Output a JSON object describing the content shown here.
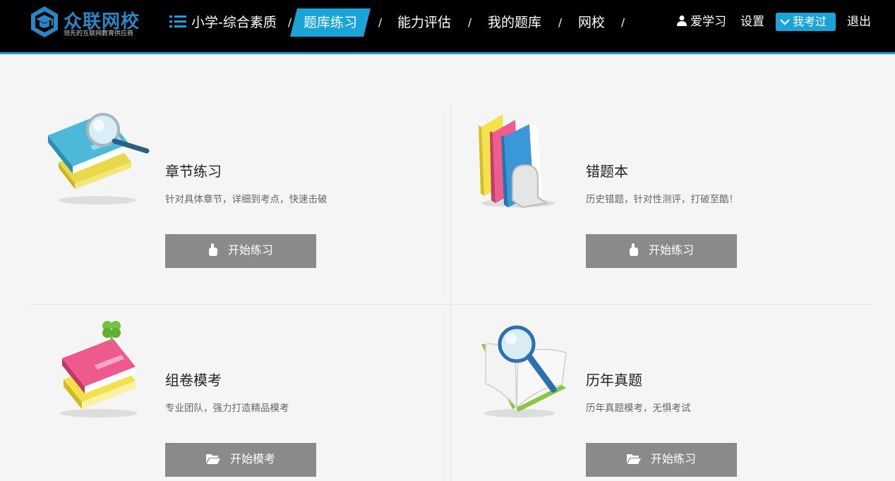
{
  "brand": {
    "name": "众联网校",
    "slogan": "领先的互联网教育供应商",
    "accent": "#1aa3d6",
    "logo_color": "#2b86c5"
  },
  "nav": {
    "menu_icon": "list-icon",
    "items": [
      {
        "label": "小学-综合素质"
      },
      {
        "label": "题库练习",
        "active": true
      },
      {
        "label": "能力评估"
      },
      {
        "label": "我的题库"
      },
      {
        "label": "网校"
      }
    ],
    "separator": "/"
  },
  "user": {
    "icon": "user-icon",
    "name": "爱学习",
    "settings_label": "设置",
    "exam_label": "我考过",
    "exam_icon": "chevron-down-icon",
    "logout_label": "退出"
  },
  "cards": [
    {
      "title": "章节练习",
      "desc": "针对具体章节，详细到考点，快速击破",
      "button": "开始练习",
      "image": "book-magnifier-icon",
      "button_icon": "hand-icon"
    },
    {
      "title": "错题本",
      "desc": "历史错题，针对性测评，打破至酷！",
      "button": "开始练习",
      "image": "books-bookend-icon",
      "button_icon": "hand-icon"
    },
    {
      "title": "组卷模考",
      "desc": "专业团队，强力打造精品模考",
      "button": "开始模考",
      "image": "book-clover-icon",
      "button_icon": "folder-open-icon"
    },
    {
      "title": "历年真题",
      "desc": "历年真题模考，无惧考试",
      "button": "开始练习",
      "image": "open-book-magnifier-icon",
      "button_icon": "folder-open-icon"
    }
  ],
  "colors": {
    "header_bg": "#000000",
    "page_bg": "#f5f5f5",
    "button_bg": "#8a8a8a"
  }
}
